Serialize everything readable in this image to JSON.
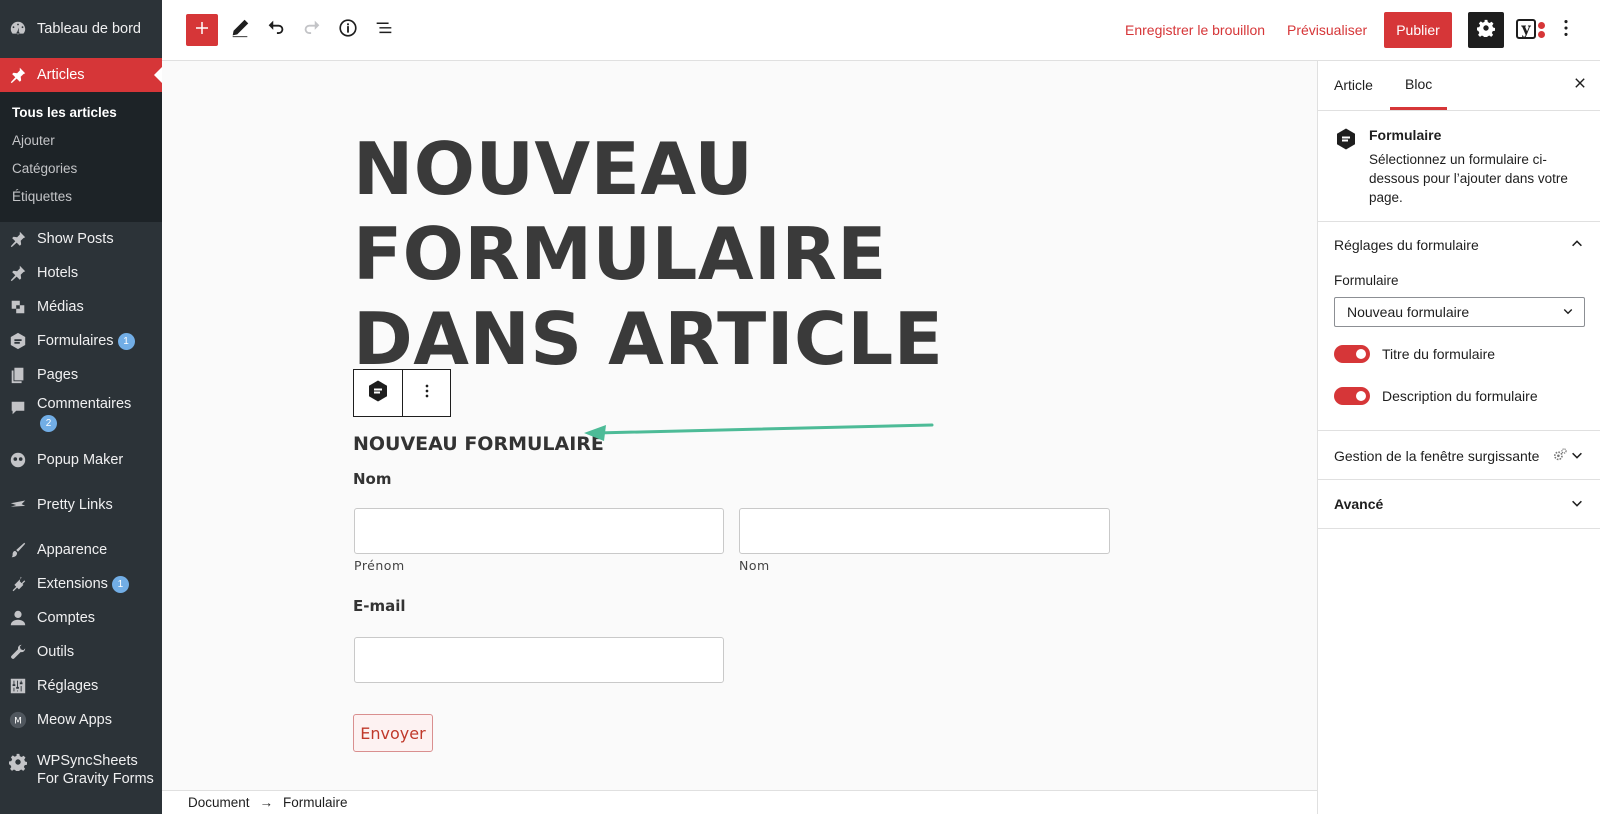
{
  "sidebar": {
    "items": [
      {
        "label": "Tableau de bord",
        "icon": "dashboard-icon"
      },
      {
        "label": "Articles",
        "icon": "pin-icon"
      },
      {
        "label": "Show Posts",
        "icon": "pin-icon"
      },
      {
        "label": "Hotels",
        "icon": "pin-icon"
      },
      {
        "label": "Médias",
        "icon": "media-icon"
      },
      {
        "label": "Formulaires",
        "icon": "gravity-forms-icon",
        "badge": "1"
      },
      {
        "label": "Pages",
        "icon": "pages-icon"
      },
      {
        "label": "Commentaires",
        "icon": "comment-icon",
        "badge": "2"
      },
      {
        "label": "Popup Maker",
        "icon": "popup-maker-icon"
      },
      {
        "label": "Pretty Links",
        "icon": "pretty-links-icon"
      },
      {
        "label": "Apparence",
        "icon": "brush-icon"
      },
      {
        "label": "Extensions",
        "icon": "plugin-icon",
        "badge": "1"
      },
      {
        "label": "Comptes",
        "icon": "user-icon"
      },
      {
        "label": "Outils",
        "icon": "wrench-icon"
      },
      {
        "label": "Réglages",
        "icon": "settings-sliders-icon"
      },
      {
        "label": "Meow Apps",
        "icon": "meow-apps-icon"
      },
      {
        "label": "WPSyncSheets",
        "label2": "For Gravity Forms",
        "icon": "gear-icon"
      }
    ],
    "submenu": [
      "Tous les articles",
      "Ajouter",
      "Catégories",
      "Étiquettes"
    ]
  },
  "toolbar": {
    "save_draft": "Enregistrer le brouillon",
    "preview": "Prévisualiser",
    "publish": "Publier",
    "yoast_letter": "y"
  },
  "editor": {
    "title": "NOUVEAU FORMULAIRE DANS ARTICLE",
    "form_title": "NOUVEAU FORMULAIRE",
    "field_name_label": "Nom",
    "first_name_sub": "Prénom",
    "last_name_sub": "Nom",
    "email_label": "E-mail",
    "submit_label": "Envoyer"
  },
  "breadcrumb": [
    "Document",
    "Formulaire"
  ],
  "panel": {
    "tabs": [
      "Article",
      "Bloc"
    ],
    "active_tab": "Bloc",
    "block_name": "Formulaire",
    "block_description": "Sélectionnez un formulaire ci-dessous pour l’ajouter dans votre page.",
    "form_settings_title": "Réglages du formulaire",
    "form_select_label": "Formulaire",
    "form_select_value": "Nouveau formulaire",
    "toggle_title_label": "Titre du formulaire",
    "toggle_title_on": true,
    "toggle_desc_label": "Description du formulaire",
    "toggle_desc_on": true,
    "popup_section": "Gestion de la fenêtre surgissante",
    "advanced_section": "Avancé"
  },
  "colors": {
    "accent": "#d63638",
    "sidebar_bg": "#2c3338",
    "arrow": "#4dbb97"
  }
}
